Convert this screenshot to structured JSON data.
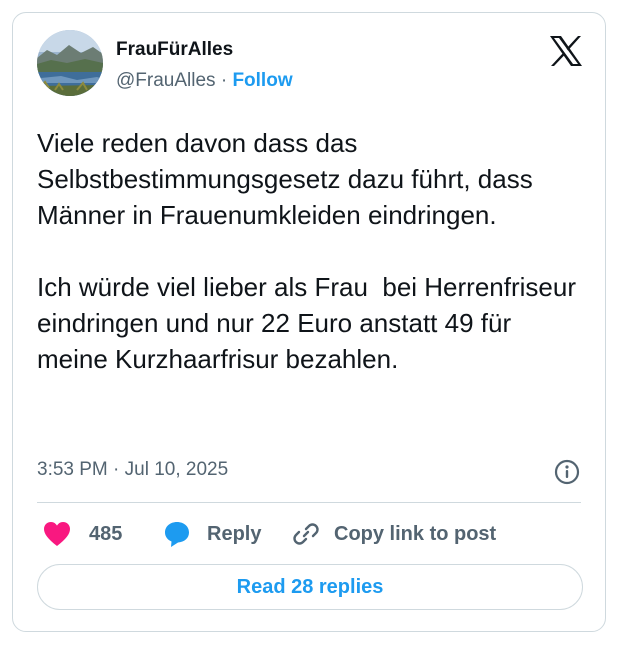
{
  "author": {
    "name": "FrauFürAlles",
    "handle": "@FrauAlles",
    "separator": " · ",
    "follow_label": "Follow",
    "avatar": "landscape-lake-photo"
  },
  "brand_logo": "x-logo-icon",
  "tweet": {
    "paragraphs": [
      "Viele reden davon dass das Selbstbestimmungsgesetz dazu führt, dass Männer in Frauenumkleiden eindringen.",
      "Ich würde viel lieber als Frau  bei Herrenfriseur eindringen und nur 22 Euro anstatt 49 für meine Kurzhaarfrisur bezahlen."
    ],
    "timestamp": "3:53 PM · Jul 10, 2025"
  },
  "actions": {
    "like_count": "485",
    "reply_label": "Reply",
    "copy_label": "Copy link to post"
  },
  "read_replies_label": "Read 28 replies",
  "colors": {
    "accent": "#1d9bf0",
    "like": "#f91880",
    "text": "#0f1419",
    "muted": "#536471",
    "border": "#cfd9de"
  }
}
